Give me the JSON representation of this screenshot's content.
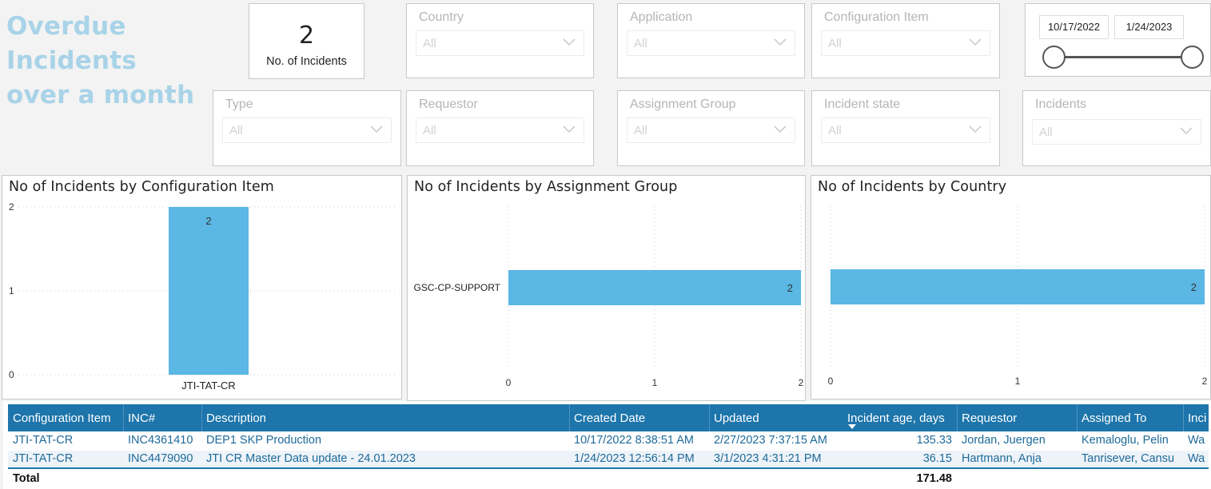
{
  "header": {
    "title_line1": "Overdue Incidents",
    "title_line2": "over a month"
  },
  "kpi": {
    "value": "2",
    "label": "No. of Incidents"
  },
  "slicers": {
    "country": {
      "label": "Country",
      "value": "All"
    },
    "application": {
      "label": "Application",
      "value": "All"
    },
    "configuration_item": {
      "label": "Configuration Item",
      "value": "All"
    },
    "type": {
      "label": "Type",
      "value": "All"
    },
    "requestor": {
      "label": "Requestor",
      "value": "All"
    },
    "assignment_group": {
      "label": "Assignment Group",
      "value": "All"
    },
    "incident_state": {
      "label": "Incident state",
      "value": "All"
    },
    "incidents": {
      "label": "Incidents",
      "value": "All"
    }
  },
  "date_range": {
    "start": "10/17/2022",
    "end": "1/24/2023"
  },
  "colors": {
    "bar": "#5bb7e4",
    "header": "#1d75ab",
    "title": "#a8d3e8"
  },
  "chart_data": [
    {
      "type": "bar",
      "title": "No of Incidents by Configuration Item",
      "categories": [
        "JTI-TAT-CR"
      ],
      "values": [
        2
      ],
      "ylim": [
        0,
        2
      ],
      "yticks": [
        "0",
        "1",
        "2"
      ],
      "data_labels": [
        "2"
      ]
    },
    {
      "type": "bar",
      "orientation": "horizontal",
      "title": "No of Incidents by Assignment Group",
      "categories": [
        "GSC-CP-SUPPORT"
      ],
      "values": [
        2
      ],
      "xlim": [
        0,
        2
      ],
      "xticks": [
        "0",
        "1",
        "2"
      ],
      "data_labels": [
        "2"
      ]
    },
    {
      "type": "bar",
      "orientation": "horizontal",
      "title": "No of Incidents by Country",
      "categories": [
        ""
      ],
      "values": [
        2
      ],
      "xlim": [
        0,
        2
      ],
      "xticks": [
        "0",
        "1",
        "2"
      ],
      "data_labels": [
        "2"
      ]
    }
  ],
  "table": {
    "columns": [
      "Configuration Item",
      "INC#",
      "Description",
      "Created Date",
      "Updated",
      "Incident age, days",
      "Requestor",
      "Assigned To",
      "Inci"
    ],
    "rows": [
      [
        "JTI-TAT-CR",
        "INC4361410",
        "DEP1 SKP Production",
        "10/17/2022 8:38:51 AM",
        "2/27/2023 7:37:15 AM",
        "135.33",
        "Jordan, Juergen",
        "Kemaloglu, Pelin",
        "Wa"
      ],
      [
        "JTI-TAT-CR",
        "INC4479090",
        "JTI CR Master Data update - 24.01.2023",
        "1/24/2023 12:56:14 PM",
        "3/1/2023 4:31:21 PM",
        "36.15",
        "Hartmann, Anja",
        "Tanrisever, Cansu",
        "Wa"
      ]
    ],
    "total_label": "Total",
    "total_value": "171.48"
  }
}
